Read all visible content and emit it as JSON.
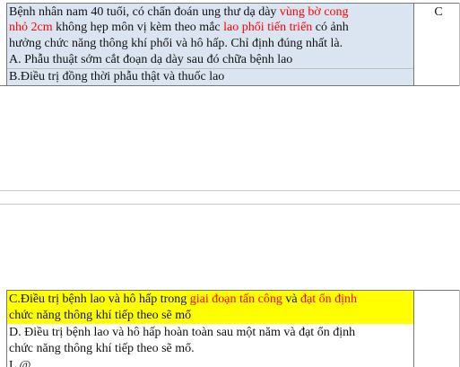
{
  "question": {
    "line1": {
      "pre": "Bệnh nhân nam 40 tuổi, có chẩn đoán ung thư dạ dày ",
      "red": "vùng bờ cong"
    },
    "line2": {
      "red1": "nhỏ 2cm",
      "mid": " không hẹp môn vị kèm theo mắc ",
      "red2": "lao phổi tiến triển",
      "post": " có ảnh"
    },
    "line3": "hưởng chức năng thông khí phổi và hô hấp. Chỉ định đúng nhất là.",
    "optionA": "A. Phẫu thuật sớm cắt đoạn dạ dày sau đó chữa bệnh lao",
    "optionB": "B.Điều trị đồng thời phẫu thật và thuốc lao"
  },
  "answer": "C",
  "options_continued": {
    "optionC_line1": {
      "pre": "C.Điều trị bệnh lao và hô hấp trong ",
      "red1": "giai đoạn tấn công",
      "mid": " và ",
      "red2": "đạt ổn định"
    },
    "optionC_line2": "chức năng thông khí tiếp theo sẽ mổ",
    "optionD_line1": "D. Điều trị bệnh lao và hô hấp hoàn toàn sau một năm và đạt ổn định",
    "optionD_line2": "chức năng thông khí tiếp theo sẽ mổ.",
    "partial_next": "L @"
  }
}
